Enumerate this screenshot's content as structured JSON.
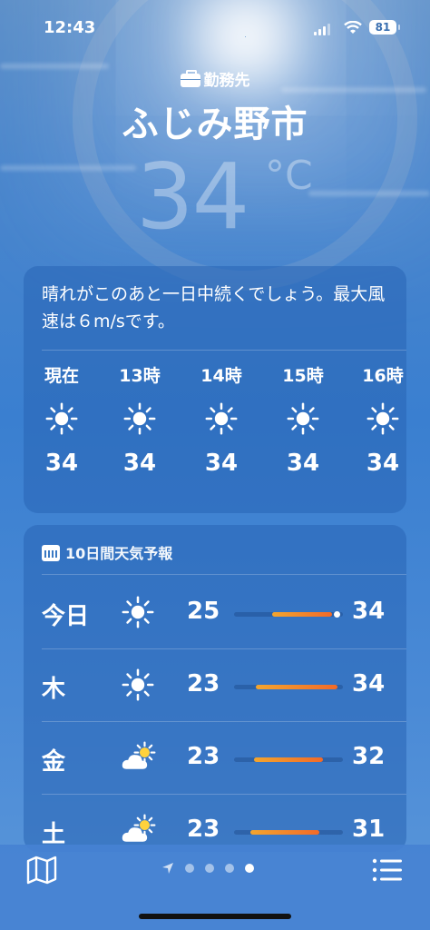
{
  "status_bar": {
    "time": "12:43",
    "battery": "81"
  },
  "header": {
    "location_label": "勤務先",
    "city": "ふじみ野市",
    "temperature": "34",
    "unit": "°C"
  },
  "summary": {
    "text": "晴れがこのあと一日中続くでしょう。最大風速は６m/sです。",
    "hourly": [
      {
        "label": "現在",
        "icon": "sun-icon",
        "temp": "34"
      },
      {
        "label": "13時",
        "icon": "sun-icon",
        "temp": "34"
      },
      {
        "label": "14時",
        "icon": "sun-icon",
        "temp": "34"
      },
      {
        "label": "15時",
        "icon": "sun-icon",
        "temp": "34"
      },
      {
        "label": "16時",
        "icon": "sun-icon",
        "temp": "34"
      }
    ]
  },
  "forecast": {
    "title": "10日間天気予報",
    "days": [
      {
        "day": "今日",
        "icon": "sun-icon",
        "low": "25",
        "high": "34",
        "range_start": 0.35,
        "range_end": 0.9,
        "current": 0.95
      },
      {
        "day": "木",
        "icon": "sun-icon",
        "low": "23",
        "high": "34",
        "range_start": 0.2,
        "range_end": 0.95
      },
      {
        "day": "金",
        "icon": "partly-cloudy-icon",
        "low": "23",
        "high": "32",
        "range_start": 0.18,
        "range_end": 0.82
      },
      {
        "day": "土",
        "icon": "partly-cloudy-icon",
        "low": "23",
        "high": "31",
        "range_start": 0.15,
        "range_end": 0.78
      }
    ]
  },
  "bottom_bar": {
    "pages": 4,
    "active_page": 3
  },
  "colors": {
    "accent_bar_start": "#f3a52e",
    "accent_bar_end": "#f26a28"
  }
}
